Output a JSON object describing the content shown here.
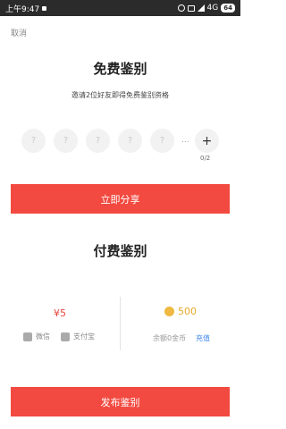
{
  "status_bar": {
    "time": "上午9:47",
    "network": "4G",
    "battery": "64"
  },
  "cancel_label": "取消",
  "free": {
    "title": "免费鉴别",
    "description": "邀请2位好友即得免费鉴别资格",
    "slot_placeholder": "?",
    "dots": "...",
    "add_symbol": "+",
    "count": "0/2",
    "share_button": "立即分享"
  },
  "paid": {
    "title": "付费鉴别",
    "price": "¥5",
    "coins": "500",
    "wechat_label": "微信",
    "alipay_label": "支付宝",
    "balance": "余额0金币",
    "recharge_label": "充值"
  },
  "publish_button": "发布鉴别",
  "colors": {
    "accent_red": "#f24a40",
    "coin_gold": "#e9a827",
    "link_blue": "#3d86e8"
  }
}
